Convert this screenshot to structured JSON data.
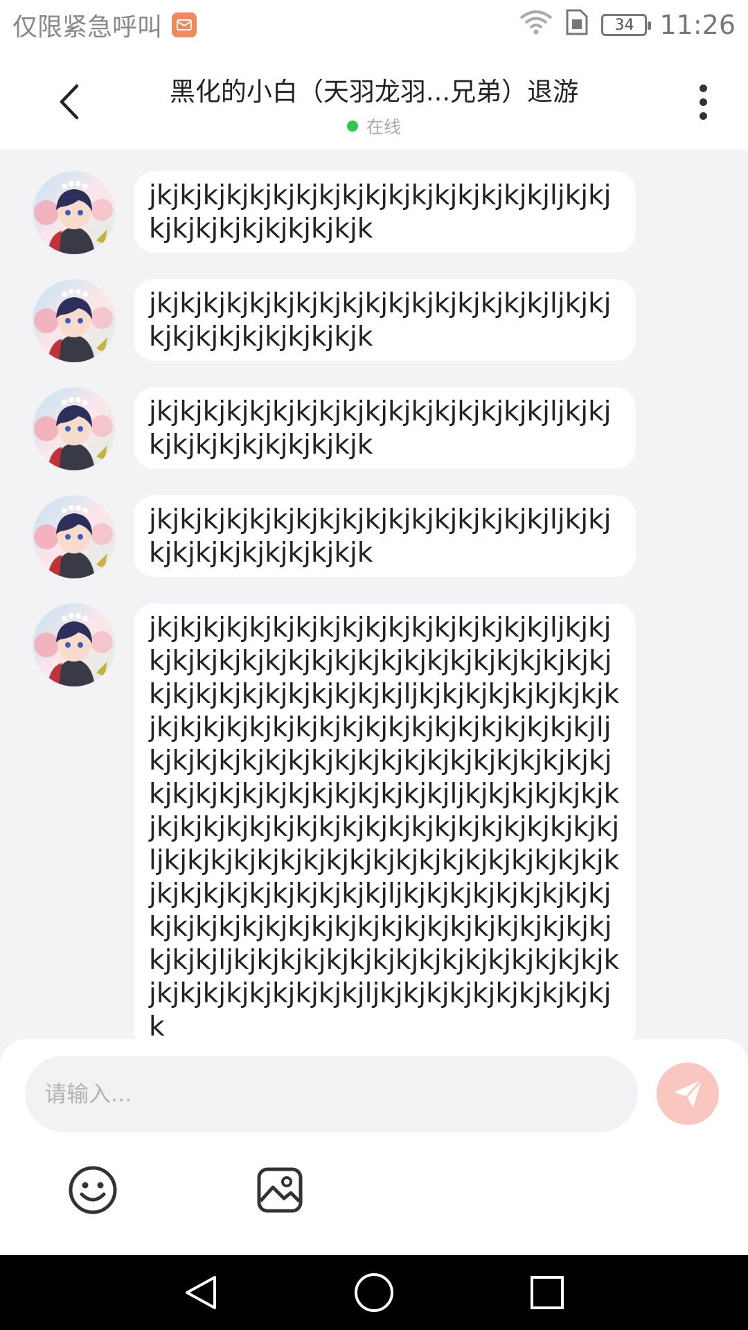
{
  "status_bar": {
    "carrier_text": "仅限紧急呼叫",
    "battery": "34",
    "time": "11:26",
    "icons": [
      "mail-icon",
      "wifi-icon",
      "sim-icon",
      "battery-icon"
    ]
  },
  "header": {
    "title": "黑化的小白（天羽龙羽...兄弟）退游",
    "status": "在线",
    "status_color": "#2fc64a"
  },
  "messages": [
    {
      "text": "jkjkjkjkjkjkjkjkjkjkjkjkjkjkjkjkjkjljkjkjkjkjkjkjkjkjkjkjkjk"
    },
    {
      "text": "jkjkjkjkjkjkjkjkjkjkjkjkjkjkjkjkjkjljkjkjkjkjkjkjkjkjkjkjkjk"
    },
    {
      "text": "jkjkjkjkjkjkjkjkjkjkjkjkjkjkjkjkjkjljkjkjkjkjkjkjkjkjkjkjkjk"
    },
    {
      "text": "jkjkjkjkjkjkjkjkjkjkjkjkjkjkjkjkjkjljkjkjkjkjkjkjkjkjkjkjkjk"
    },
    {
      "text": "jkjkjkjkjkjkjkjkjkjkjkjkjkjkjkjkjkjljkjkjkjkjkjkjkjkjkjkjkjkjkjkjkjkjkjkjkjkjkjkjkjkjkjkjkjkjkjkjkjkjkjljkjkjkjkjkjkjkjkjkjkjkjkjkjkjkjkjkjkjkjkjkjkjkjkjkjkjkjkjljkjkjkjkjkjkjkjkjkjkjkjkjkjkjkjkjkjkjkjkjkjkjkjkjkjkjkjkjkjkjkjkjkjljkjkjkjkjkjkjkjkjkjkjkjkjkjkjkjkjkjkjkjkjkjkjkjkjkjkjkjljkjkjkjkjkjkjkjkjkjkjkjkjkjkjkjkjkjkjkjkjkjkjkjkjkjkjkjkjkjkjljkjkjkjkjkjkjkjkjkjkjkjkjkjkjkjkjkjkjkjkjkjkjkjkjkjkjkjkjkjkjkjkjljkjkjkjkjkjkjkjkjkjkjkjkjkjkjkjkjkjkjkjkjkjkjkjkjkjkjljkjkjkjkjkjkjkjkjkjkjk"
    }
  ],
  "composer": {
    "placeholder": "请输入...",
    "send_color": "#f9c6c0"
  },
  "toolbar": {
    "icons": [
      "emoji-icon",
      "image-icon"
    ]
  },
  "nav_bar": {
    "icons": [
      "back-triangle-icon",
      "home-circle-icon",
      "recent-square-icon"
    ]
  }
}
